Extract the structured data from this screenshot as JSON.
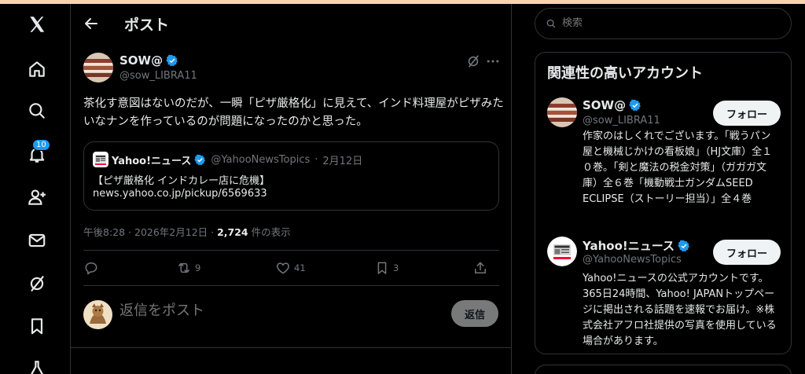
{
  "nav": {
    "items": [
      {
        "icon": "x-logo-icon"
      },
      {
        "icon": "home-icon"
      },
      {
        "icon": "search-icon"
      },
      {
        "icon": "notifications-icon",
        "badge": "10"
      },
      {
        "icon": "follow-icon"
      },
      {
        "icon": "messages-icon"
      },
      {
        "icon": "grok-icon"
      },
      {
        "icon": "bookmarks-icon"
      },
      {
        "icon": "labs-icon"
      }
    ]
  },
  "header": {
    "title": "ポスト"
  },
  "post": {
    "author_name": "SOW@",
    "author_handle": "@sow_LIBRA11",
    "text": "茶化す意図はないのだが、一瞬「ピザ厳格化」に見えて、インド料理屋がピザみたいなナンを作っているのが問題になったのかと思った。",
    "quote": {
      "name": "Yahoo!ニュース",
      "handle": "@YahooNewsTopics",
      "date": "2月12日",
      "line1": "【ピザ厳格化 インドカレー店に危機】",
      "line2": "news.yahoo.co.jp/pickup/6569633"
    },
    "timestamp": "午後8:28 · 2026年2月12日 · ",
    "views_count": "2,724",
    "views_label": " 件の表示",
    "actions": {
      "reply": "",
      "repost": "9",
      "like": "41",
      "bookmark": "3"
    }
  },
  "reply": {
    "placeholder": "返信をポスト",
    "button_label": "返信"
  },
  "search": {
    "placeholder": "検索"
  },
  "related": {
    "title": "関連性の高いアカウント",
    "accounts": [
      {
        "name": "SOW@",
        "handle": "@sow_LIBRA11",
        "follow_label": "フォロー",
        "bio": "作家のはしくれでございます。「戦うパン屋と機械じかけの看板娘」（HJ文庫）全１０巻。「剣と魔法の税金対策」（ガガガ文庫）全６巻「機動戦士ガンダムSEED ECLIPSE（ストーリー担当）」全４巻"
      },
      {
        "name": "Yahoo!ニュース",
        "handle": "@YahooNewsTopics",
        "follow_label": "フォロー",
        "bio": "Yahoo!ニュースの公式アカウントです。365日24時間、Yahoo! JAPANトップページに掲出される話題を速報でお届け。※株式会社アフロ社提供の写真を使用している場合があります。"
      }
    ]
  },
  "colors": {
    "accent": "#1d9bf0",
    "background": "#000000",
    "border": "#2f3336",
    "muted": "#71767b"
  }
}
